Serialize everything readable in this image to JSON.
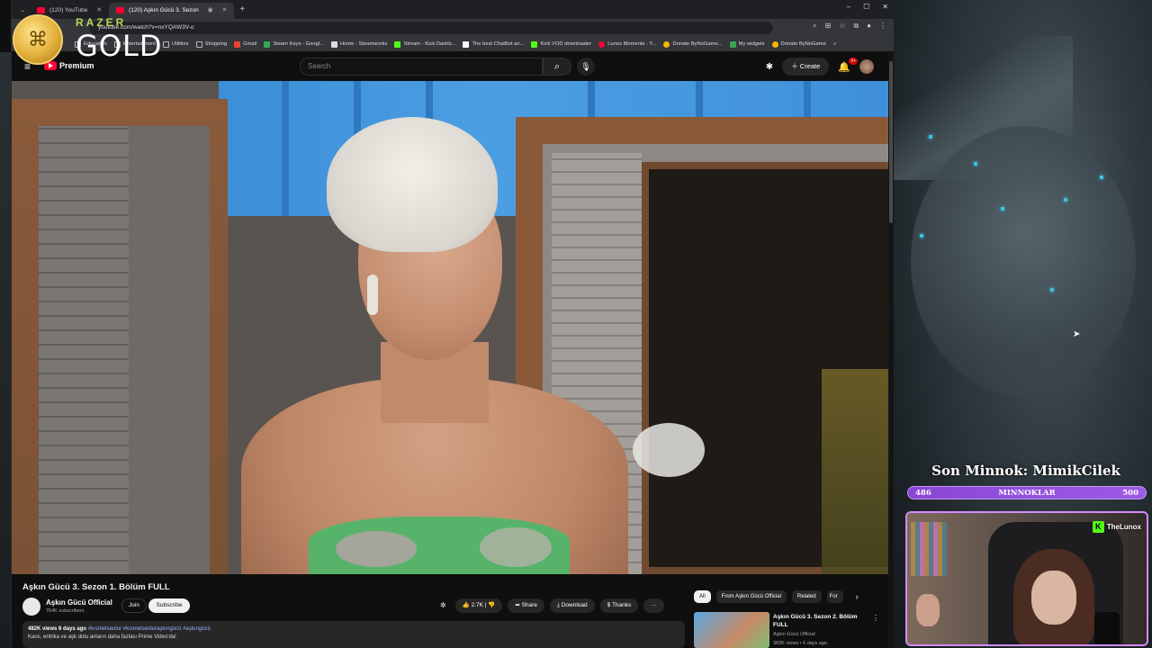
{
  "browser": {
    "tabs": [
      {
        "label": "(120) YouTube",
        "active": false
      },
      {
        "label": "(120) Aşkın Gücü 3. Sezon",
        "active": true
      }
    ],
    "url": "youtube.com/watch?v=nxYQAW3V-o",
    "bookmarks": [
      {
        "label": "Education",
        "color": "#6b8ad8"
      },
      {
        "label": "Entertainment",
        "color": "#6b8ad8"
      },
      {
        "label": "Utilities",
        "color": "#6b8ad8"
      },
      {
        "label": "Shopping",
        "color": "#6b8ad8"
      },
      {
        "label": "Gmail",
        "color": "#ea4335"
      },
      {
        "label": "Steam Keys - Googl...",
        "color": "#34a853"
      },
      {
        "label": "Home - Steamworks",
        "color": "#ffffff"
      },
      {
        "label": "Stream - Kick Dashb...",
        "color": "#53fc18"
      },
      {
        "label": "The best ChatBot an...",
        "color": "#ffffff"
      },
      {
        "label": "Kick VOD downloader",
        "color": "#53fc18"
      },
      {
        "label": "Lunox Moments - Y...",
        "color": "#ff0033"
      },
      {
        "label": "Donate ByNoGame...",
        "color": "#f4b400"
      },
      {
        "label": "My widgets",
        "color": "#34a853"
      },
      {
        "label": "Donate ByNoGame",
        "color": "#f4b400"
      }
    ]
  },
  "razer": {
    "brand": "RAZER",
    "tier": "GOLD"
  },
  "youtube": {
    "logo_label": "Premium",
    "search_placeholder": "Search",
    "create_label": "Create",
    "notif_badge": "9+",
    "video": {
      "title": "Aşkın Gücü 3. Sezon 1. Bölüm FULL",
      "channel": "Aşkın Gücü Official",
      "subscribers": "764K subscribers",
      "join_label": "Join",
      "subscribe_label": "Subscribe",
      "likes": "2.7K",
      "share_label": "Share",
      "download_label": "Download",
      "thanks_label": "Thanks",
      "views_date": "482K views  6 days ago",
      "hashtags": "#kısmetseolur #kısmetseoluraşkıngücü #aşkıngücü",
      "description": "Kaos, entrika ve aşk dolu anların daha fazlası Prime Video'da!"
    },
    "chips": [
      "All",
      "From Aşkın Gücü Official",
      "Related",
      "For"
    ],
    "recommended": {
      "title": "Aşkın Gücü 3. Sezon 2. Bölüm FULL",
      "channel": "Aşkın Gücü Official",
      "meta": "382K views • 6 days ago"
    }
  },
  "overlay": {
    "last_sub": "Son Minnok: MimikCilek",
    "goal": {
      "current": "486",
      "label": "MINNOKLAR",
      "target": "500",
      "progress": 0.972
    },
    "streamer_tag": "TheLunox",
    "colors": {
      "goal_bar": "#8a46d4",
      "kick_green": "#53fc18",
      "cam_border": "#d38bff"
    }
  }
}
